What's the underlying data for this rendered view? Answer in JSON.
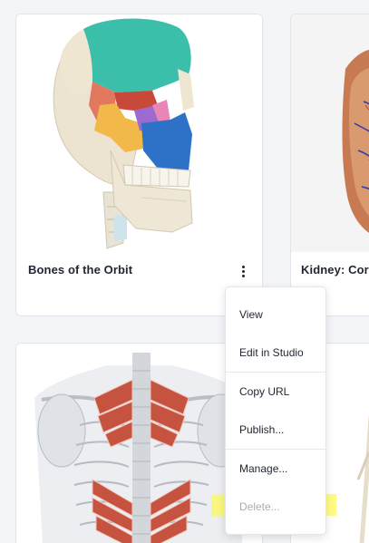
{
  "cards": [
    {
      "title": "Bones of the Orbit"
    },
    {
      "title": "Kidney: Cor"
    },
    {
      "title": ""
    },
    {
      "title": ""
    }
  ],
  "menu": {
    "items": [
      {
        "label": "View"
      },
      {
        "label": "Edit in Studio"
      },
      {
        "label": "Copy URL"
      },
      {
        "label": "Publish..."
      },
      {
        "label": "Manage..."
      },
      {
        "label": "Delete..."
      }
    ]
  },
  "icons": {
    "kebab": "more-vertical-icon"
  },
  "colors": {
    "background": "#f4f5f9",
    "text": "#1f2533",
    "disabled_text": "#a8acb6",
    "highlight": "#fffa5a"
  }
}
